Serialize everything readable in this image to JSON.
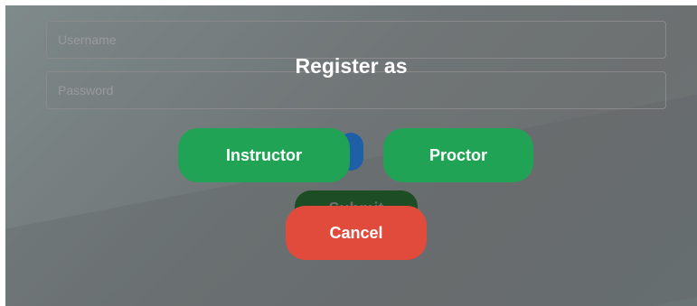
{
  "form": {
    "username_placeholder": "Username",
    "password_placeholder": "Password",
    "submit_label": "Submit"
  },
  "modal": {
    "title": "Register as",
    "instructor_label": "Instructor",
    "proctor_label": "Proctor",
    "cancel_label": "Cancel"
  },
  "colors": {
    "success_green": "#21a356",
    "danger_red": "#e14b3b",
    "overlay_grey": "#6f7576"
  }
}
